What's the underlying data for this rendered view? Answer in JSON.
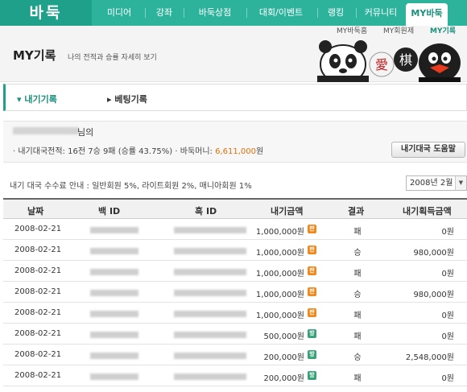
{
  "logo": "바둑",
  "nav": {
    "items": [
      "미디어",
      "강좌",
      "바둑상점",
      "대회/이벤트",
      "랭킹",
      "커뮤니티",
      "MY바둑"
    ],
    "active": "MY바둑"
  },
  "subnav": {
    "items": [
      "MY바둑홈",
      "MY회원제",
      "MY기록"
    ],
    "active": "MY기록"
  },
  "header": {
    "title": "MY기록",
    "subtitle": "나의 전적과 승률 자세히 보기",
    "mascot_chars": [
      "愛",
      "棋"
    ]
  },
  "tabs": {
    "items": [
      "내기기록",
      "베팅기록"
    ],
    "active": "내기기록",
    "active_prefix": "▾",
    "inactive_prefix": "▸"
  },
  "summary": {
    "user_suffix": "님의",
    "record_prefix": "· 내기대국전적: 16전 7승 9패 (승률 43.75%)  · 바둑머니: ",
    "money": "6,611,000",
    "money_unit": "원",
    "help_button": "내기대국 도움말"
  },
  "fee_info": "내기 대국 수수료 안내 : 일반회원 5%, 라이트회원 2%, 매니아회원 1%",
  "date_select": {
    "value": "2008년 2월"
  },
  "table": {
    "headers": [
      "날짜",
      "백 ID",
      "흑 ID",
      "내기금액",
      "결과",
      "내기획득금액"
    ],
    "rows": [
      {
        "date": "2008-02-21",
        "bet": "1,000,000원",
        "badge": "판",
        "badge_color": "orange",
        "result": "패",
        "won": "0원"
      },
      {
        "date": "2008-02-21",
        "bet": "1,000,000원",
        "badge": "판",
        "badge_color": "orange",
        "result": "승",
        "won": "980,000원"
      },
      {
        "date": "2008-02-21",
        "bet": "1,000,000원",
        "badge": "판",
        "badge_color": "orange",
        "result": "패",
        "won": "0원"
      },
      {
        "date": "2008-02-21",
        "bet": "1,000,000원",
        "badge": "판",
        "badge_color": "orange",
        "result": "승",
        "won": "980,000원"
      },
      {
        "date": "2008-02-21",
        "bet": "1,000,000원",
        "badge": "판",
        "badge_color": "orange",
        "result": "패",
        "won": "0원"
      },
      {
        "date": "2008-02-21",
        "bet": "500,000원",
        "badge": "방",
        "badge_color": "green",
        "result": "패",
        "won": "0원"
      },
      {
        "date": "2008-02-21",
        "bet": "200,000원",
        "badge": "방",
        "badge_color": "green",
        "result": "승",
        "won": "2,548,000원"
      },
      {
        "date": "2008-02-21",
        "bet": "200,000원",
        "badge": "방",
        "badge_color": "green",
        "result": "패",
        "won": "0원"
      }
    ]
  },
  "colors": {
    "brand": "#1fa08a",
    "money": "#e0700a",
    "badge_orange": "#f08a1e",
    "badge_green": "#3aa27a"
  }
}
